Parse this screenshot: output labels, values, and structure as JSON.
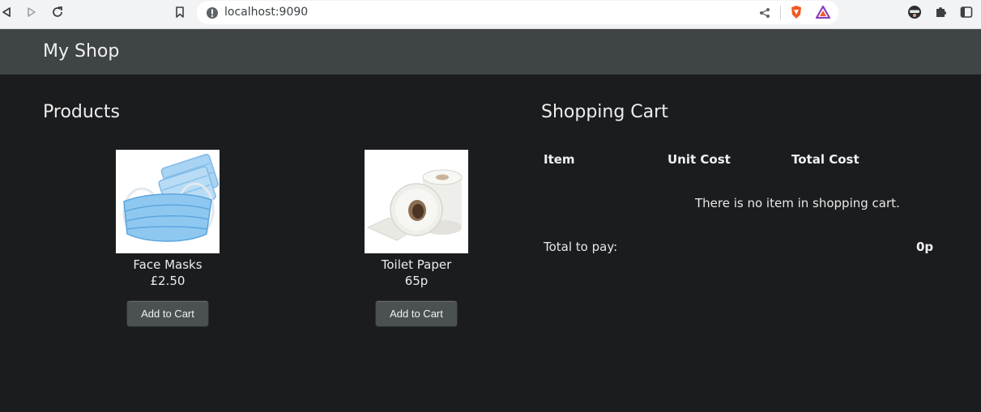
{
  "browser": {
    "url": "localhost:9090"
  },
  "navbar": {
    "brand": "My Shop"
  },
  "products": {
    "title": "Products",
    "items": [
      {
        "name": "Face Masks",
        "price": "£2.50",
        "button": "Add to Cart"
      },
      {
        "name": "Toilet Paper",
        "price": "65p",
        "button": "Add to Cart"
      }
    ]
  },
  "cart": {
    "title": "Shopping Cart",
    "columns": [
      "Item",
      "Unit Cost",
      "Total Cost"
    ],
    "empty_message": "There is no item in shopping cart.",
    "total_label": "Total to pay:",
    "total_value": "0p"
  },
  "colors": {
    "page_bg": "#1b1c1e",
    "navbar_bg": "#3f4446",
    "button_bg": "#4b5053"
  }
}
